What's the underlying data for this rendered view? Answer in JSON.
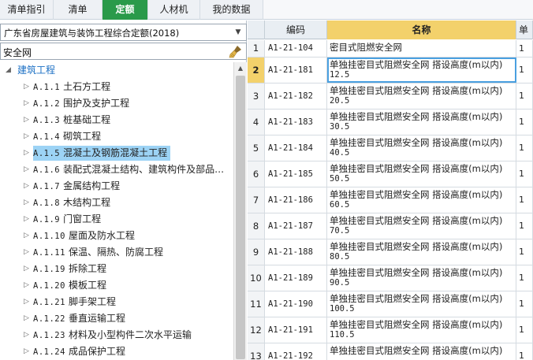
{
  "tabs": [
    {
      "label": "清单指引",
      "active": false
    },
    {
      "label": "清单",
      "active": false
    },
    {
      "label": "定额",
      "active": true
    },
    {
      "label": "人材机",
      "active": false
    },
    {
      "label": "我的数据",
      "active": false
    }
  ],
  "library": {
    "selected": "广东省房屋建筑与装饰工程综合定额(2018)"
  },
  "search": {
    "value": "安全网"
  },
  "tree": {
    "root": "建筑工程",
    "items": [
      {
        "code": "A.1.1",
        "label": "土石方工程"
      },
      {
        "code": "A.1.2",
        "label": "围护及支护工程"
      },
      {
        "code": "A.1.3",
        "label": "桩基础工程"
      },
      {
        "code": "A.1.4",
        "label": "砌筑工程"
      },
      {
        "code": "A.1.5",
        "label": "混凝土及钢筋混凝土工程",
        "selected": true
      },
      {
        "code": "A.1.6",
        "label": "装配式混凝土结构、建筑构件及部品…"
      },
      {
        "code": "A.1.7",
        "label": "金属结构工程"
      },
      {
        "code": "A.1.8",
        "label": "木结构工程"
      },
      {
        "code": "A.1.9",
        "label": "门窗工程"
      },
      {
        "code": "A.1.10",
        "label": "屋面及防水工程"
      },
      {
        "code": "A.1.11",
        "label": "保温、隔热、防腐工程"
      },
      {
        "code": "A.1.19",
        "label": "拆除工程"
      },
      {
        "code": "A.1.20",
        "label": "模板工程"
      },
      {
        "code": "A.1.21",
        "label": "脚手架工程"
      },
      {
        "code": "A.1.22",
        "label": "垂直运输工程"
      },
      {
        "code": "A.1.23",
        "label": "材料及小型构件二次水平运输"
      },
      {
        "code": "A.1.24",
        "label": "成品保护工程"
      }
    ]
  },
  "grid": {
    "headers": {
      "code": "编码",
      "name": "名称",
      "extra": "单"
    },
    "rows": [
      {
        "num": "1",
        "code": "A1-21-104",
        "name1": "密目式阻燃安全网",
        "name2": "",
        "extra": "1"
      },
      {
        "num": "2",
        "code": "A1-21-181",
        "name1": "单独挂密目式阻燃安全网 搭设高度(m以内)",
        "name2": "12.5",
        "extra": "1",
        "selected": true
      },
      {
        "num": "3",
        "code": "A1-21-182",
        "name1": "单独挂密目式阻燃安全网 搭设高度(m以内)",
        "name2": "20.5",
        "extra": "1"
      },
      {
        "num": "4",
        "code": "A1-21-183",
        "name1": "单独挂密目式阻燃安全网 搭设高度(m以内)",
        "name2": "30.5",
        "extra": "1"
      },
      {
        "num": "5",
        "code": "A1-21-184",
        "name1": "单独挂密目式阻燃安全网 搭设高度(m以内)",
        "name2": "40.5",
        "extra": "1"
      },
      {
        "num": "6",
        "code": "A1-21-185",
        "name1": "单独挂密目式阻燃安全网 搭设高度(m以内)",
        "name2": "50.5",
        "extra": "1"
      },
      {
        "num": "7",
        "code": "A1-21-186",
        "name1": "单独挂密目式阻燃安全网 搭设高度(m以内)",
        "name2": "60.5",
        "extra": "1"
      },
      {
        "num": "8",
        "code": "A1-21-187",
        "name1": "单独挂密目式阻燃安全网 搭设高度(m以内)",
        "name2": "70.5",
        "extra": "1"
      },
      {
        "num": "9",
        "code": "A1-21-188",
        "name1": "单独挂密目式阻燃安全网 搭设高度(m以内)",
        "name2": "80.5",
        "extra": "1"
      },
      {
        "num": "10",
        "code": "A1-21-189",
        "name1": "单独挂密目式阻燃安全网 搭设高度(m以内)",
        "name2": "90.5",
        "extra": "1"
      },
      {
        "num": "11",
        "code": "A1-21-190",
        "name1": "单独挂密目式阻燃安全网 搭设高度(m以内)",
        "name2": "100.5",
        "extra": "1"
      },
      {
        "num": "12",
        "code": "A1-21-191",
        "name1": "单独挂密目式阻燃安全网 搭设高度(m以内)",
        "name2": "110.5",
        "extra": "1"
      },
      {
        "num": "13",
        "code": "A1-21-192",
        "name1": "单独挂密目式阻燃安全网 搭设高度(m以内)",
        "name2": "",
        "extra": "1"
      }
    ]
  },
  "icons": {
    "library_dropdown": "chevron-down-icon",
    "search_clear": "brush-icon",
    "tree_expanded": "triangle-down-icon",
    "tree_collapsed": "triangle-right-icon"
  },
  "colors": {
    "active_tab": "#2a9a4a",
    "header_highlight": "#f3d16b",
    "tree_selection": "#9cd3f5",
    "selection_outline": "#4aa0e0"
  }
}
